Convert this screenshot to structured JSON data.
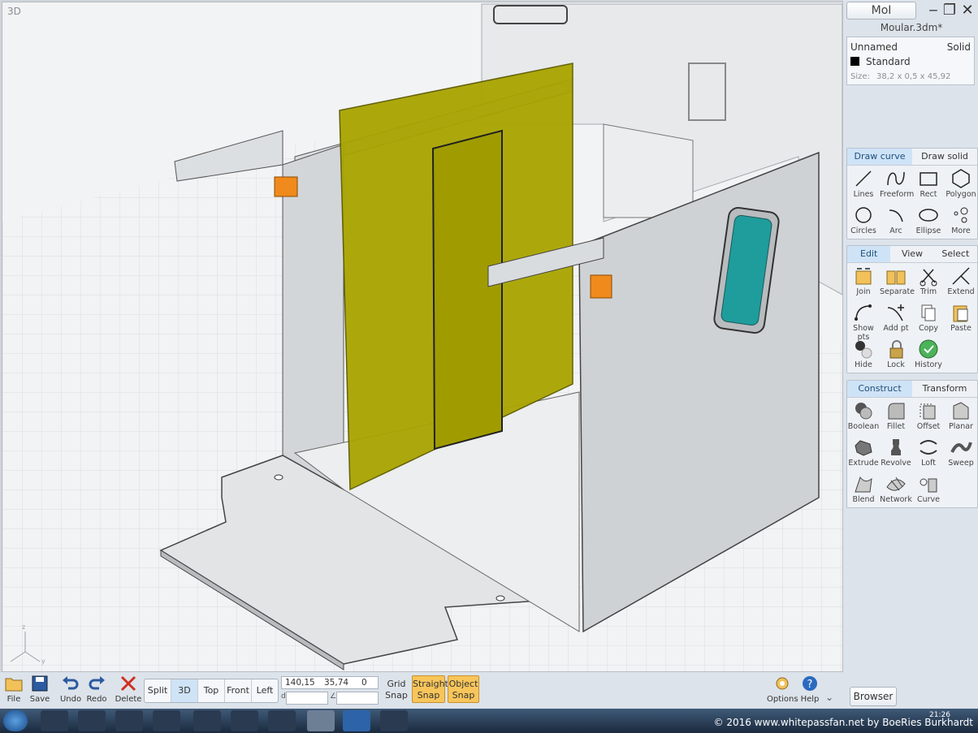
{
  "viewport": {
    "label": "3D"
  },
  "titlebar": {
    "app_button": "MoI",
    "filename": "Moular.3dm*"
  },
  "properties": {
    "name": "Unnamed",
    "type": "Solid",
    "layer": "Standard",
    "size_label": "Size:",
    "size_value": "38,2 x 0,5 x 45,92"
  },
  "draw_panel": {
    "tabs": [
      "Draw curve",
      "Draw solid"
    ],
    "tools": [
      {
        "label": "Lines",
        "icon": "lines-icon"
      },
      {
        "label": "Freeform",
        "icon": "freeform-icon"
      },
      {
        "label": "Rect",
        "icon": "rect-icon"
      },
      {
        "label": "Polygon",
        "icon": "polygon-icon"
      },
      {
        "label": "Circles",
        "icon": "circles-icon"
      },
      {
        "label": "Arc",
        "icon": "arc-icon"
      },
      {
        "label": "Ellipse",
        "icon": "ellipse-icon"
      },
      {
        "label": "More",
        "icon": "more-icon"
      }
    ]
  },
  "edit_panel": {
    "tabs": [
      "Edit",
      "View",
      "Select"
    ],
    "tools": [
      {
        "label": "Join",
        "icon": "join-icon"
      },
      {
        "label": "Separate",
        "icon": "separate-icon"
      },
      {
        "label": "Trim",
        "icon": "trim-icon"
      },
      {
        "label": "Extend",
        "icon": "extend-icon"
      },
      {
        "label": "Show pts",
        "icon": "show-points-icon"
      },
      {
        "label": "Add pt",
        "icon": "add-point-icon"
      },
      {
        "label": "Copy",
        "icon": "copy-icon"
      },
      {
        "label": "Paste",
        "icon": "paste-icon"
      },
      {
        "label": "Hide",
        "icon": "hide-icon"
      },
      {
        "label": "Lock",
        "icon": "lock-icon"
      },
      {
        "label": "History",
        "icon": "history-icon"
      }
    ]
  },
  "construct_panel": {
    "tabs": [
      "Construct",
      "Transform"
    ],
    "tools": [
      {
        "label": "Boolean",
        "icon": "boolean-icon"
      },
      {
        "label": "Fillet",
        "icon": "fillet-icon"
      },
      {
        "label": "Offset",
        "icon": "offset-icon"
      },
      {
        "label": "Planar",
        "icon": "planar-icon"
      },
      {
        "label": "Extrude",
        "icon": "extrude-icon"
      },
      {
        "label": "Revolve",
        "icon": "revolve-icon"
      },
      {
        "label": "Loft",
        "icon": "loft-icon"
      },
      {
        "label": "Sweep",
        "icon": "sweep-icon"
      },
      {
        "label": "Blend",
        "icon": "blend-icon"
      },
      {
        "label": "Network",
        "icon": "network-icon"
      },
      {
        "label": "Curve",
        "icon": "curve-icon"
      }
    ]
  },
  "bottom": {
    "file": "File",
    "save": "Save",
    "undo": "Undo",
    "redo": "Redo",
    "delete": "Delete",
    "views": [
      "Split",
      "3D",
      "Top",
      "Front",
      "Left"
    ],
    "coords": {
      "x": "140,15",
      "y": "35,74",
      "z": "0",
      "d_label": "d",
      "angle_label": "∠"
    },
    "grid_snap": [
      "Grid",
      "Snap"
    ],
    "straight_snap": [
      "Straight",
      "Snap"
    ],
    "object_snap": [
      "Object",
      "Snap"
    ],
    "options": "Options",
    "help": "Help",
    "browser": "Browser"
  },
  "taskbar": {
    "copyright": "© 2016 www.whitepassfan.net by BoeRies Burkhardt",
    "time": "21:26"
  },
  "colors": {
    "selected_face": "#a9a400",
    "window_glass": "#1f9c9c",
    "clamp": "#f08a1c",
    "accent": "#cfe3f7"
  }
}
